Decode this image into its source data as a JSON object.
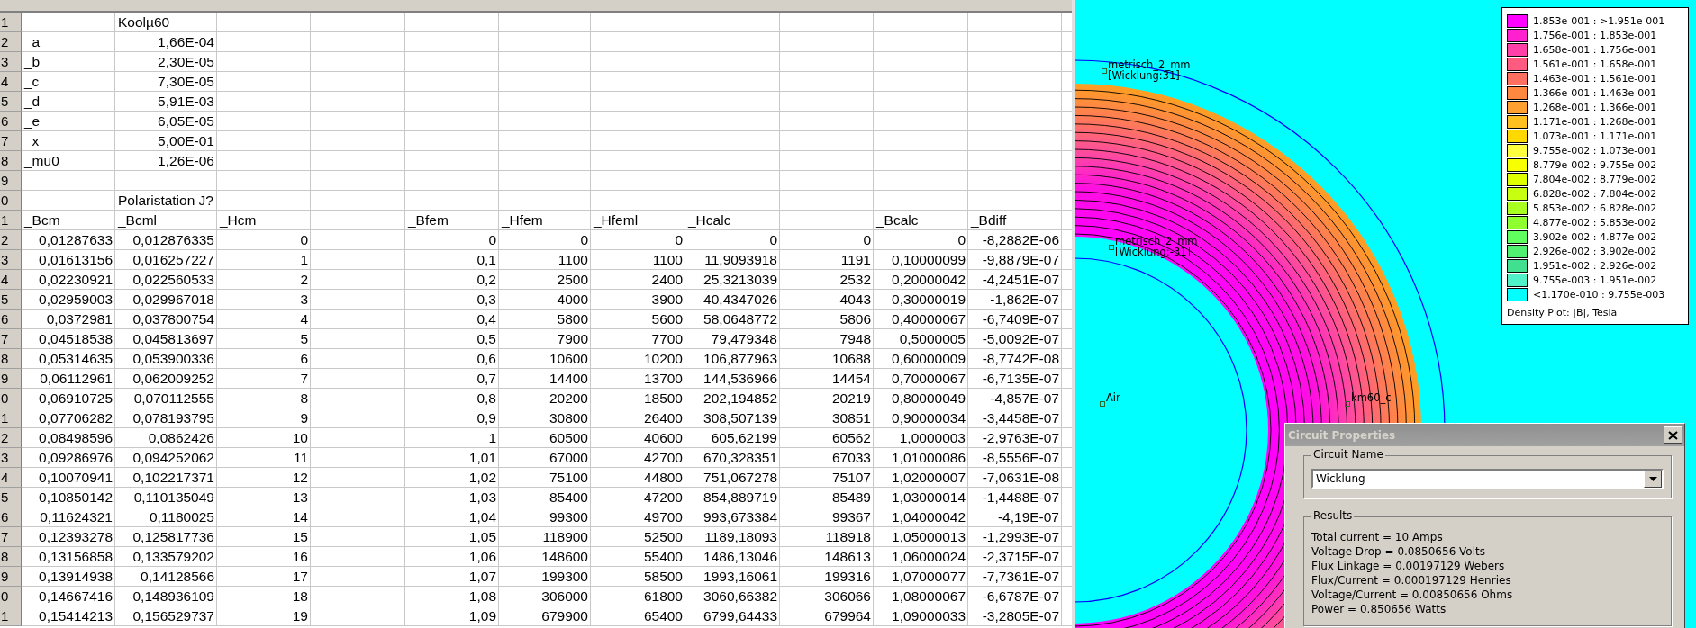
{
  "spreadsheet": {
    "row_numbers": [
      "1",
      "2",
      "3",
      "4",
      "5",
      "6",
      "7",
      "8",
      "9",
      "0",
      "1",
      "2",
      "3",
      "4",
      "5",
      "6",
      "7",
      "8",
      "9",
      "0",
      "1",
      "2",
      "3",
      "4",
      "5",
      "6",
      "7",
      "8",
      "9",
      "0",
      "1"
    ],
    "title": "Koolµ60",
    "parameters": [
      {
        "name": "_a",
        "value": "1,66E-04"
      },
      {
        "name": "_b",
        "value": "2,30E-05"
      },
      {
        "name": "_c",
        "value": "7,30E-05"
      },
      {
        "name": "_d",
        "value": "5,91E-03"
      },
      {
        "name": "_e",
        "value": "6,05E-05"
      },
      {
        "name": "_x",
        "value": "5,00E-01"
      },
      {
        "name": "_mu0",
        "value": "1,26E-06"
      }
    ],
    "note": "Polaristation J?",
    "columns": [
      {
        "kind": "data",
        "heading": "_Bcm",
        "values": [
          "0,01287633",
          "0,01613156",
          "0,02230921",
          "0,02959003",
          "0,0372981",
          "0,04518538",
          "0,05314635",
          "0,06112961",
          "0,06910725",
          "0,07706282",
          "0,08498596",
          "0,09286976",
          "0,10070941",
          "0,10850142",
          "0,11624321",
          "0,12393278",
          "0,13156858",
          "0,13914938",
          "0,14667416",
          "0,15414213"
        ]
      },
      {
        "kind": "data",
        "heading": "_Bcml",
        "values": [
          "0,012876335",
          "0,016257227",
          "0,022560533",
          "0,029967018",
          "0,037800754",
          "0,045813697",
          "0,053900336",
          "0,062009252",
          "0,070112555",
          "0,078193795",
          "0,0862426",
          "0,094252062",
          "0,102217371",
          "0,110135049",
          "0,1180025",
          "0,125817736",
          "0,133579202",
          "0,14128566",
          "0,148936109",
          "0,156529737"
        ]
      },
      {
        "kind": "data",
        "heading": "_Hcm",
        "values": [
          "0",
          "1",
          "2",
          "3",
          "4",
          "5",
          "6",
          "7",
          "8",
          "9",
          "10",
          "11",
          "12",
          "13",
          "14",
          "15",
          "16",
          "17",
          "18",
          "19"
        ]
      },
      {
        "kind": "blank"
      },
      {
        "kind": "data",
        "heading": "_Bfem",
        "values": [
          "0",
          "0,1",
          "0,2",
          "0,3",
          "0,4",
          "0,5",
          "0,6",
          "0,7",
          "0,8",
          "0,9",
          "1",
          "1,01",
          "1,02",
          "1,03",
          "1,04",
          "1,05",
          "1,06",
          "1,07",
          "1,08",
          "1,09"
        ]
      },
      {
        "kind": "data",
        "heading": "_Hfem",
        "values": [
          "0",
          "1100",
          "2500",
          "4000",
          "5800",
          "7900",
          "10600",
          "14400",
          "20200",
          "30800",
          "60500",
          "67000",
          "75100",
          "85400",
          "99300",
          "118900",
          "148600",
          "199300",
          "306000",
          "679900"
        ]
      },
      {
        "kind": "data",
        "heading": "_Hfeml",
        "values": [
          "0",
          "1100",
          "2400",
          "3900",
          "5600",
          "7700",
          "10200",
          "13700",
          "18500",
          "26400",
          "40600",
          "42700",
          "44800",
          "47200",
          "49700",
          "52500",
          "55400",
          "58500",
          "61800",
          "65400"
        ]
      },
      {
        "kind": "data",
        "heading": "_Hcalc",
        "values": [
          "0",
          "11,9093918",
          "25,3213039",
          "40,4347026",
          "58,0648772",
          "79,479348",
          "106,877963",
          "144,536966",
          "202,194852",
          "308,507139",
          "605,62199",
          "670,328351",
          "751,067278",
          "854,889719",
          "993,673384",
          "1189,18093",
          "1486,13046",
          "1993,16061",
          "3060,66382",
          "6799,64433"
        ]
      },
      {
        "kind": "data",
        "values": [
          "0",
          "1191",
          "2532",
          "4043",
          "5806",
          "7948",
          "10688",
          "14454",
          "20219",
          "30851",
          "60562",
          "67033",
          "75107",
          "85489",
          "99367",
          "118918",
          "148613",
          "199316",
          "306066",
          "679964"
        ]
      },
      {
        "kind": "data",
        "heading": "_Bcalc",
        "values": [
          "0",
          "0,10000099",
          "0,20000042",
          "0,30000019",
          "0,40000067",
          "0,5000005",
          "0,60000009",
          "0,70000067",
          "0,80000049",
          "0,90000034",
          "1,0000003",
          "1,01000086",
          "1,02000007",
          "1,03000014",
          "1,04000042",
          "1,05000013",
          "1,06000024",
          "1,07000077",
          "1,08000067",
          "1,09000033"
        ]
      },
      {
        "kind": "data",
        "heading": "_Bdiff",
        "values": [
          "-8,2882E-06",
          "-9,8879E-07",
          "-4,2451E-07",
          "-1,862E-07",
          "-6,7409E-07",
          "-5,0092E-07",
          "-8,7742E-08",
          "-6,7135E-07",
          "-4,857E-07",
          "-3,4458E-07",
          "-2,9763E-07",
          "-8,5556E-07",
          "-7,0631E-08",
          "-1,4488E-07",
          "-4,19E-07",
          "-1,2993E-07",
          "-2,3715E-07",
          "-7,7361E-07",
          "-6,6787E-07",
          "-3,2805E-07"
        ]
      }
    ]
  },
  "field_plot": {
    "labels": [
      {
        "lines": [
          "metrisch_2_mm",
          "[Wicklung:31]"
        ]
      },
      {
        "lines": [
          "metrisch_2_mm",
          "[Wicklung:-31]"
        ]
      },
      {
        "lines": [
          "Air"
        ]
      },
      {
        "lines": [
          "km60_c"
        ]
      }
    ],
    "legend": {
      "entries": [
        {
          "range": "1.853e-001 : >1.951e-001",
          "color": "#ff00ff"
        },
        {
          "range": "1.756e-001 : 1.853e-001",
          "color": "#ff20d0"
        },
        {
          "range": "1.658e-001 : 1.756e-001",
          "color": "#ff40a8"
        },
        {
          "range": "1.561e-001 : 1.658e-001",
          "color": "#ff5a80"
        },
        {
          "range": "1.463e-001 : 1.561e-001",
          "color": "#ff7060"
        },
        {
          "range": "1.366e-001 : 1.463e-001",
          "color": "#ff8840"
        },
        {
          "range": "1.268e-001 : 1.366e-001",
          "color": "#ffa030"
        },
        {
          "range": "1.171e-001 : 1.268e-001",
          "color": "#ffc020"
        },
        {
          "range": "1.073e-001 : 1.171e-001",
          "color": "#ffd800"
        },
        {
          "range": "9.755e-002 : 1.073e-001",
          "color": "#ffff40"
        },
        {
          "range": "8.779e-002 : 9.755e-002",
          "color": "#f8ff00"
        },
        {
          "range": "7.804e-002 : 8.779e-002",
          "color": "#e0ff00"
        },
        {
          "range": "6.828e-002 : 7.804e-002",
          "color": "#c8ff10"
        },
        {
          "range": "5.853e-002 : 6.828e-002",
          "color": "#a8ff20"
        },
        {
          "range": "4.877e-002 : 5.853e-002",
          "color": "#90ff30"
        },
        {
          "range": "3.902e-002 : 4.877e-002",
          "color": "#60ff60"
        },
        {
          "range": "2.926e-002 : 3.902e-002",
          "color": "#50f070"
        },
        {
          "range": "1.951e-002 : 2.926e-002",
          "color": "#40e090"
        },
        {
          "range": "9.755e-003 : 1.951e-002",
          "color": "#50f0c8"
        },
        {
          "range": "<1.170e-010 : 9.755e-003",
          "color": "#00ffff"
        }
      ],
      "caption": "Density Plot: |B|, Tesla"
    }
  },
  "dialog": {
    "title": "Circuit Properties",
    "circuit_name_label": "Circuit Name",
    "circuit_name": "Wicklung",
    "results_label": "Results",
    "results": [
      "Total current = 10 Amps",
      "Voltage Drop = 0.0850656 Volts",
      "Flux Linkage = 0.00197129 Webers",
      "Flux/Current = 0.000197129 Henries",
      "Voltage/Current = 0.00850656 Ohms",
      "Power = 0.850656 Watts"
    ]
  }
}
